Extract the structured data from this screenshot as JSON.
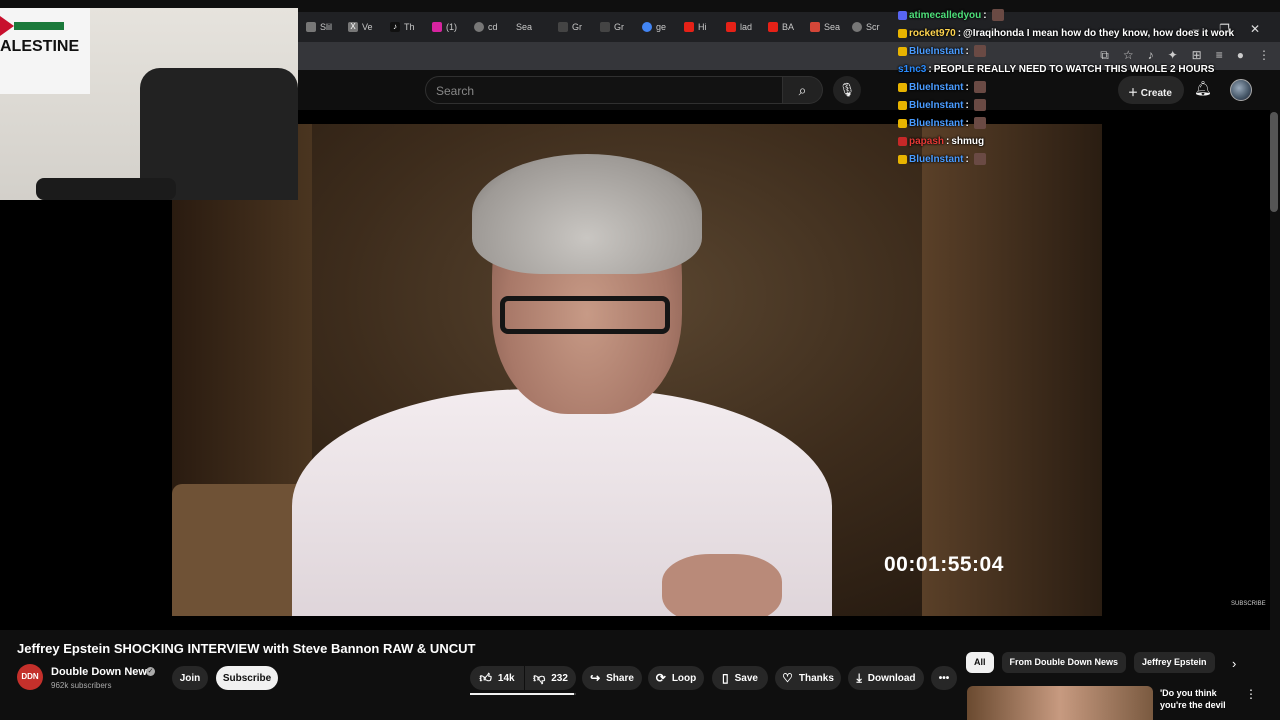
{
  "browser": {
    "tabs": [
      "Slil",
      "Ve",
      "Th",
      "(1)",
      "cd",
      "Sea",
      "Gr",
      "Gr",
      "ge",
      "Hi",
      "lad",
      "BA",
      "Sea",
      "Scr"
    ],
    "tab_icons": [
      "",
      "x-icon",
      "tiktok-icon",
      "instagram-icon",
      "globe-icon",
      "",
      "vf-icon",
      "vf-icon",
      "google-icon",
      "youtube-icon",
      "youtube-icon",
      "youtube-icon",
      "gmail-icon",
      "globe-icon"
    ]
  },
  "webcam": {
    "flag_text": "ALESTINE"
  },
  "chat": {
    "messages": [
      {
        "user": "atimecalledyou",
        "user_color": "#4ee07a",
        "message": "",
        "badge_color": "#5865f2"
      },
      {
        "user": "rocket970",
        "user_color": "#ffd54f",
        "message": "@Iraqihonda I mean how do they know, how does it work",
        "badge_color": "#e8b400"
      },
      {
        "user": "BlueInstant",
        "user_color": "#4a9cff",
        "message": "",
        "badge_color": "#e8b400"
      },
      {
        "user": "s1nc3",
        "user_color": "#2a8cff",
        "message": "PEOPLE REALLY NEED TO WATCH THIS WHOLE 2 HOURS",
        "badge_color": ""
      },
      {
        "user": "BlueInstant",
        "user_color": "#4a9cff",
        "message": "",
        "badge_color": "#e8b400"
      },
      {
        "user": "BlueInstant",
        "user_color": "#4a9cff",
        "message": "",
        "badge_color": "#e8b400"
      },
      {
        "user": "BlueInstant",
        "user_color": "#4a9cff",
        "message": "",
        "badge_color": "#e8b400"
      },
      {
        "user": "papash",
        "user_color": "#e53935",
        "message": "shmug",
        "badge_color": "#c62828"
      },
      {
        "user": "BlueInstant",
        "user_color": "#4a9cff",
        "message": "",
        "badge_color": "#e8b400"
      }
    ]
  },
  "header": {
    "search_placeholder": "Search",
    "create_label": "Create"
  },
  "video": {
    "timecode": "00:01:55:04",
    "watermark": "SUBSCRIBE",
    "title": "Jeffrey Epstein SHOCKING INTERVIEW with Steve Bannon RAW & UNCUT"
  },
  "channel": {
    "avatar_text": "DDN",
    "name": "Double Down News",
    "subscribers": "962k subscribers",
    "join_label": "Join",
    "subscribe_label": "Subscribe"
  },
  "actions": {
    "likes": "14k",
    "dislikes": "232",
    "like_ratio": 0.98,
    "share": "Share",
    "loop": "Loop",
    "save": "Save",
    "thanks": "Thanks",
    "download": "Download"
  },
  "sidebar": {
    "chips": [
      "All",
      "From Double Down News",
      "Jeffrey Epstein"
    ],
    "rec_title": "'Do you think you're the devil"
  }
}
